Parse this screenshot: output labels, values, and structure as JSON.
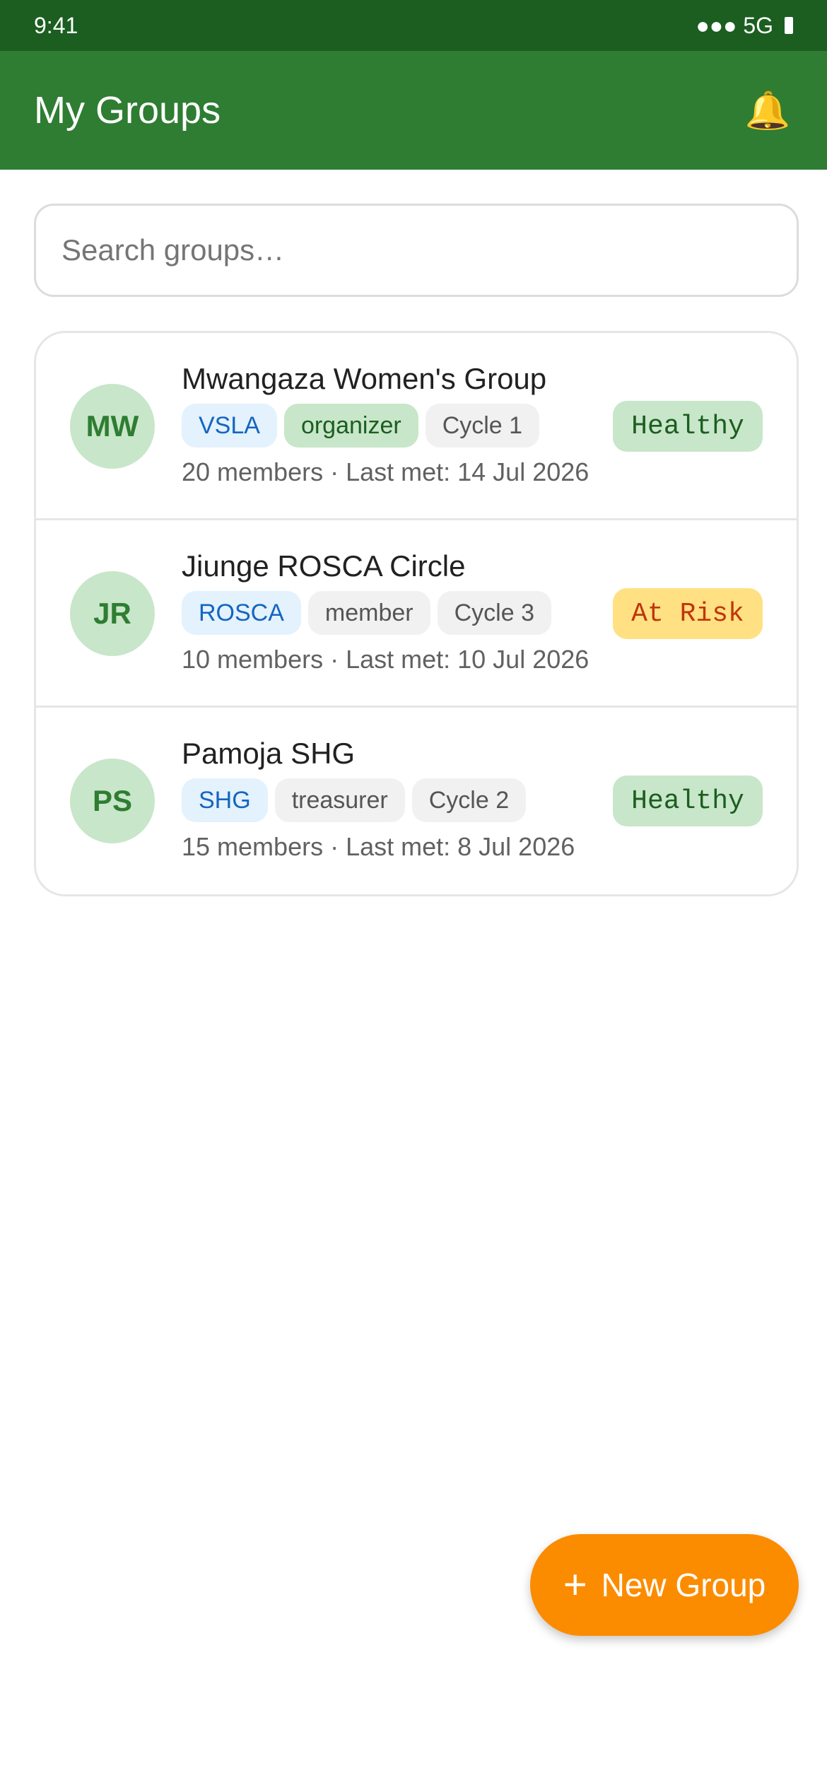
{
  "status_bar": {
    "time": "9:41",
    "signal": "●●● 5G"
  },
  "app_bar": {
    "title": "My Groups",
    "notification_icon": "🔔"
  },
  "search": {
    "placeholder": "Search groups…",
    "value": ""
  },
  "groups": [
    {
      "initials": "MW",
      "name": "Mwangaza Women's Group",
      "type": "VSLA",
      "role": "organizer",
      "cycle": "Cycle 1",
      "meta": "20 members · Last met: 14 Jul 2026",
      "status": "Healthy"
    },
    {
      "initials": "JR",
      "name": "Jiunge ROSCA Circle",
      "type": "ROSCA",
      "role": "member",
      "cycle": "Cycle 3",
      "meta": "10 members · Last met: 10 Jul 2026",
      "status": "At Risk"
    },
    {
      "initials": "PS",
      "name": "Pamoja SHG",
      "type": "SHG",
      "role": "treasurer",
      "cycle": "Cycle 2",
      "meta": "15 members · Last met: 8 Jul 2026",
      "status": "Healthy"
    }
  ],
  "fab": {
    "plus": "+",
    "label": "New Group"
  },
  "colors": {
    "primary": "#2e7d32",
    "primary_dark": "#1b5e20",
    "accent": "#fb8c00",
    "healthy_bg": "#c8e6c9",
    "at_risk_bg": "#ffe082"
  }
}
